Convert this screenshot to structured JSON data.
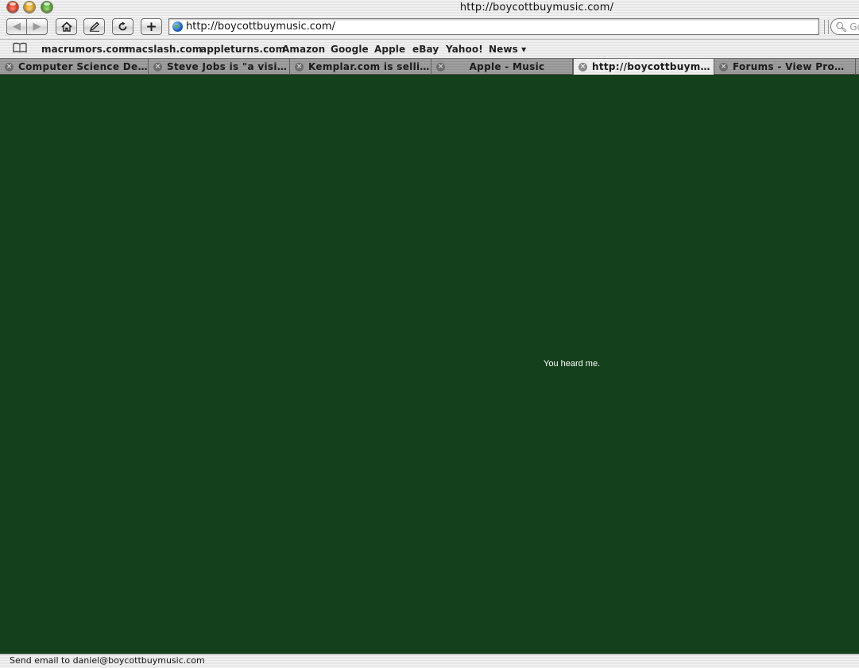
{
  "window": {
    "title": "http://boycottbuymusic.com/"
  },
  "toolbar": {
    "back_icon": "back-arrow-icon",
    "forward_icon": "forward-arrow-icon",
    "home_icon": "home-icon",
    "bookmark_icon": "pencil-icon",
    "reload_icon": "reload-icon",
    "add_icon": "plus-icon",
    "address_value": "http://boycottbuymusic.com/",
    "search_placeholder": "Go"
  },
  "bookmarks": {
    "items": [
      {
        "label": "macrumors.com"
      },
      {
        "label": "macslash.com"
      },
      {
        "label": "appleturns.com"
      },
      {
        "label": "Amazon"
      },
      {
        "label": "Google"
      },
      {
        "label": "Apple"
      },
      {
        "label": "eBay"
      },
      {
        "label": "Yahoo!"
      },
      {
        "label": "News ▾"
      }
    ]
  },
  "tabs": [
    {
      "label": "Computer Science Degree",
      "active": false
    },
    {
      "label": "Steve Jobs is \"a visiona...",
      "active": false
    },
    {
      "label": "Kemplar.com is selling ...",
      "active": false
    },
    {
      "label": "Apple - Music",
      "active": false
    },
    {
      "label": "http://boycottbuymusic....",
      "active": true
    },
    {
      "label": "Forums - View Profile",
      "active": false
    }
  ],
  "content": {
    "message": "You heard me.",
    "background_color": "#14401b"
  },
  "status": {
    "text": "Send email to daniel@boycottbuymusic.com"
  }
}
